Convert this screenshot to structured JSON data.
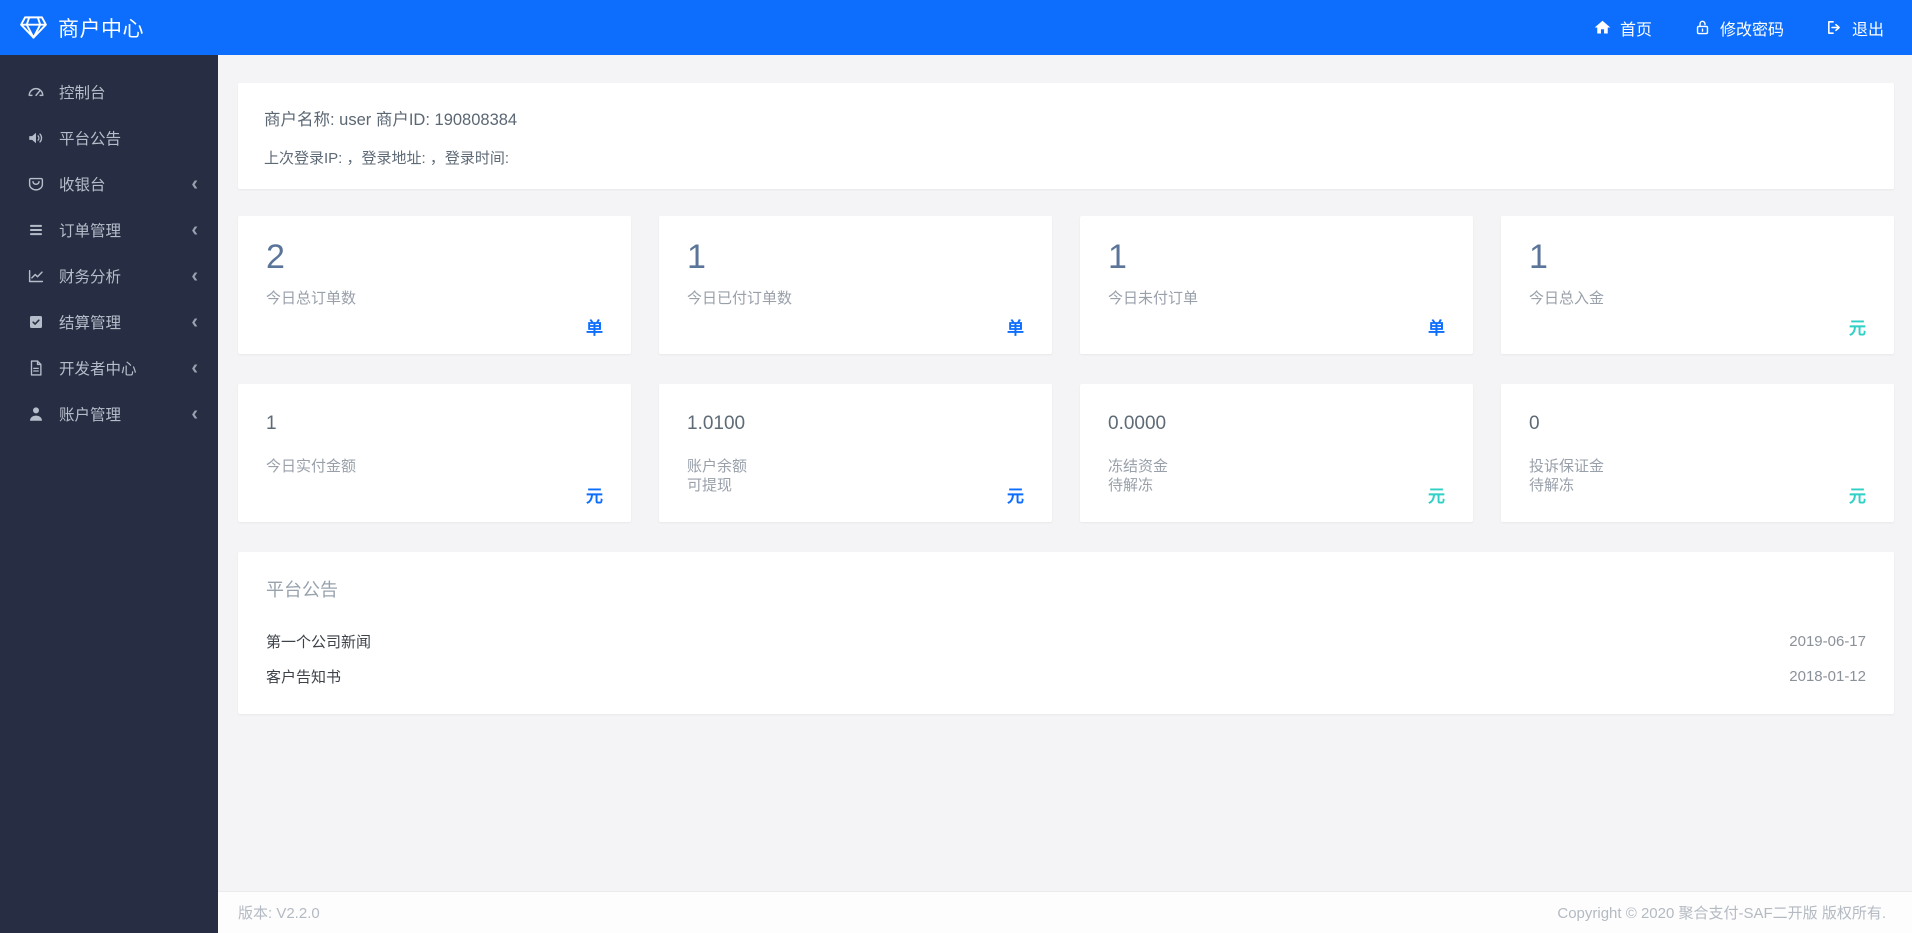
{
  "header": {
    "brand": "商户中心",
    "nav": [
      {
        "icon": "home-icon",
        "label": "首页"
      },
      {
        "icon": "unlock-icon",
        "label": "修改密码"
      },
      {
        "icon": "sign-out-icon",
        "label": "退出"
      }
    ]
  },
  "sidebar": {
    "items": [
      {
        "icon": "dashboard-icon",
        "label": "控制台",
        "expandable": false
      },
      {
        "icon": "announcement-icon",
        "label": "平台公告",
        "expandable": false
      },
      {
        "icon": "cashier-icon",
        "label": "收银台",
        "expandable": true
      },
      {
        "icon": "orders-icon",
        "label": "订单管理",
        "expandable": true
      },
      {
        "icon": "finance-icon",
        "label": "财务分析",
        "expandable": true
      },
      {
        "icon": "settlement-icon",
        "label": "结算管理",
        "expandable": true
      },
      {
        "icon": "developer-icon",
        "label": "开发者中心",
        "expandable": true
      },
      {
        "icon": "account-icon",
        "label": "账户管理",
        "expandable": true
      }
    ],
    "chevron": "‹"
  },
  "merchant_info": {
    "line1": "商户名称: user 商户ID: 190808384",
    "line2": "上次登录IP: ，登录地址: ，登录时间:"
  },
  "stats": [
    {
      "value": "2",
      "label": "今日总订单数",
      "label2": "",
      "unit": "单",
      "unit_color": "#0d6efd"
    },
    {
      "value": "1",
      "label": "今日已付订单数",
      "label2": "",
      "unit": "单",
      "unit_color": "#0d6efd"
    },
    {
      "value": "1",
      "label": "今日未付订单",
      "label2": "",
      "unit": "单",
      "unit_color": "#0d6efd"
    },
    {
      "value": "1",
      "label": "今日总入金",
      "label2": "",
      "unit": "元",
      "unit_color": "#2fd0c5"
    },
    {
      "value": "1",
      "label": "今日实付金额",
      "label2": "",
      "unit": "元",
      "unit_color": "#0d6efd"
    },
    {
      "value": "1.0100",
      "label": "账户余额",
      "label2": "可提现",
      "unit": "元",
      "unit_color": "#0d6efd"
    },
    {
      "value": "0.0000",
      "label": "冻结资金",
      "label2": "待解冻",
      "unit": "元",
      "unit_color": "#2fd0c5"
    },
    {
      "value": "0",
      "label": "投诉保证金",
      "label2": "待解冻",
      "unit": "元",
      "unit_color": "#2fd0c5"
    }
  ],
  "announcements": {
    "title": "平台公告",
    "items": [
      {
        "name": "第一个公司新闻",
        "date": "2019-06-17"
      },
      {
        "name": "客户告知书",
        "date": "2018-01-12"
      }
    ]
  },
  "footer": {
    "version": "版本: V2.2.0",
    "copyright": "Copyright © 2020 聚合支付-SAF二开版 版权所有."
  },
  "colors": {
    "header_bg": "#0d6efd",
    "sidebar_bg": "#272d42",
    "content_bg": "#f4f4f6",
    "accent_blue": "#0d6efd",
    "accent_teal": "#2fd0c5",
    "stat_value_large": "#5b7499"
  }
}
